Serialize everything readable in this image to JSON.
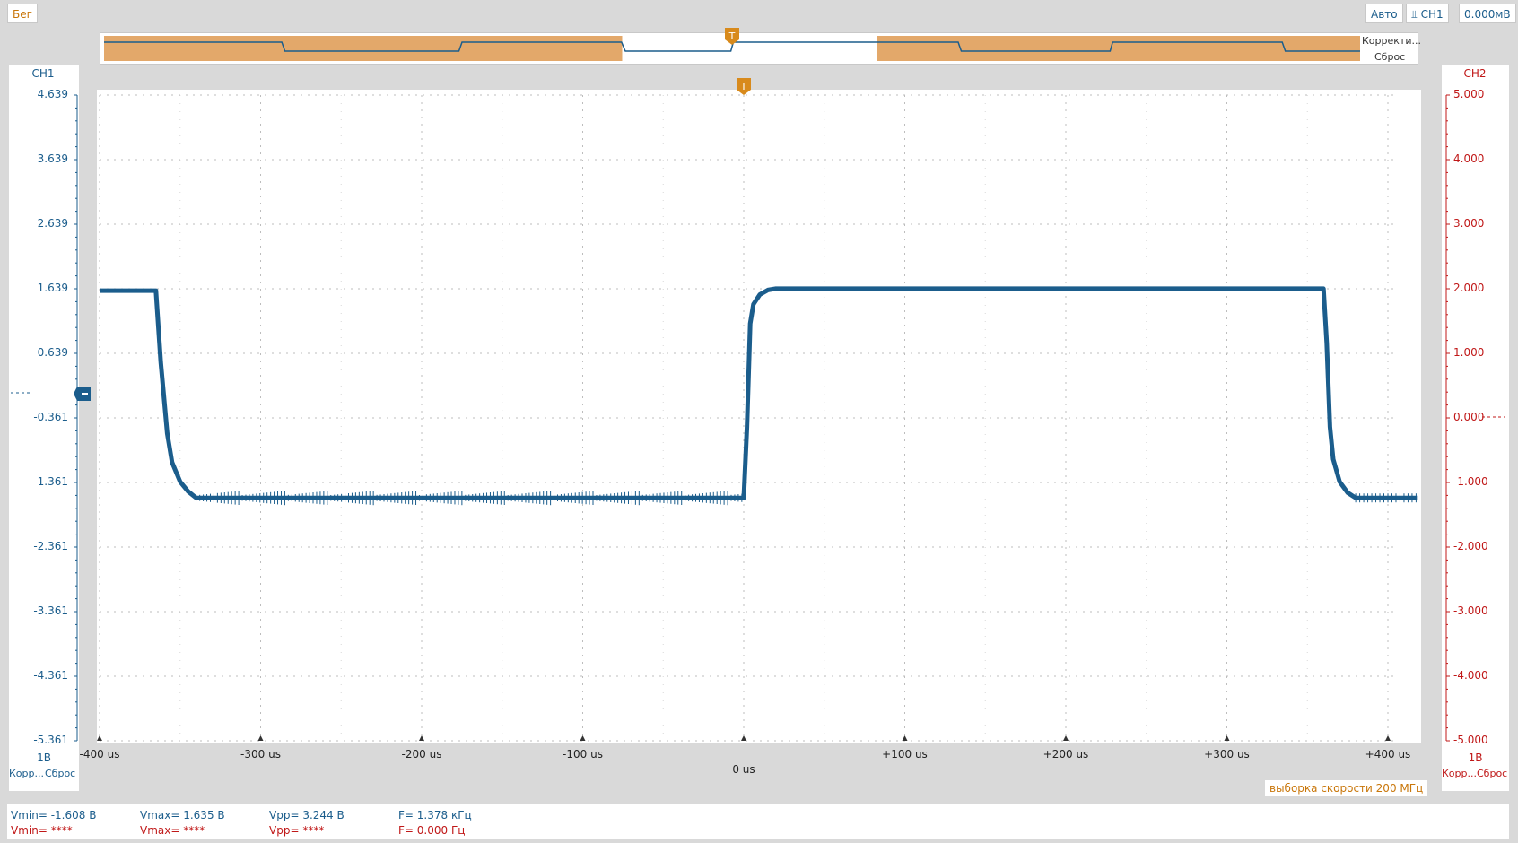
{
  "toolbar": {
    "run_label": "Бег",
    "mode_label": "Авто",
    "trigger_channel_label": "CH1",
    "trigger_level_label": "0.000мВ"
  },
  "overview": {
    "correct_label": "Корректи...",
    "reset_label": "Сброс",
    "trigger_marker": "T"
  },
  "ch1": {
    "title": "CH1",
    "scale": "1В",
    "correct_short": "Корр...",
    "reset_label": "Сброс",
    "ticks": [
      "4.639",
      "3.639",
      "2.639",
      "1.639",
      "0.639",
      "-0.361",
      "-1.361",
      "-2.361",
      "-3.361",
      "-4.361",
      "-5.361"
    ],
    "color": "#1b5d8c"
  },
  "ch2": {
    "title": "CH2",
    "scale": "1В",
    "correct_short": "Корр...",
    "reset_label": "Сброс",
    "ticks": [
      "5.000",
      "4.000",
      "3.000",
      "2.000",
      "1.000",
      "0.000",
      "-1.000",
      "-2.000",
      "-3.000",
      "-4.000",
      "-5.000"
    ],
    "color": "#c01818"
  },
  "time_axis": {
    "labels": [
      "-400 us",
      "-300 us",
      "-200 us",
      "-100 us",
      "0 us",
      "+100 us",
      "+200 us",
      "+300 us",
      "+400 us"
    ]
  },
  "plot": {
    "trigger_marker": "T",
    "sample_rate_label": "выборка скорости 200 МГц"
  },
  "measurements": {
    "ch1": {
      "vmin": "Vmin= -1.608 В",
      "vmax": "Vmax= 1.635 В",
      "vpp": "Vpp= 3.244 В",
      "freq": "F= 1.378 кГц"
    },
    "ch2": {
      "vmin": "Vmin= ****",
      "vmax": "Vmax= ****",
      "vpp": "Vpp= ****",
      "freq": "F= 0.000 Гц"
    }
  },
  "chart_data": {
    "type": "line",
    "xlabel": "",
    "ylabel": "",
    "xlim": [
      -400,
      420
    ],
    "ylim": [
      -5.361,
      4.639
    ],
    "grid": true,
    "series": [
      {
        "x": [
          -400,
          -365,
          -362,
          -358,
          -355,
          -350,
          -345,
          -340,
          0,
          2,
          4,
          6,
          10,
          15,
          20,
          360,
          362,
          364,
          366,
          370,
          375,
          380,
          418
        ],
        "y": [
          1.61,
          1.61,
          0.5,
          -0.6,
          -1.05,
          -1.35,
          -1.5,
          -1.6,
          -1.6,
          -0.5,
          1.1,
          1.4,
          1.55,
          1.62,
          1.64,
          1.64,
          0.8,
          -0.5,
          -1.0,
          -1.35,
          -1.52,
          -1.6,
          -1.6
        ],
        "color": "#1b5d8c"
      }
    ]
  }
}
